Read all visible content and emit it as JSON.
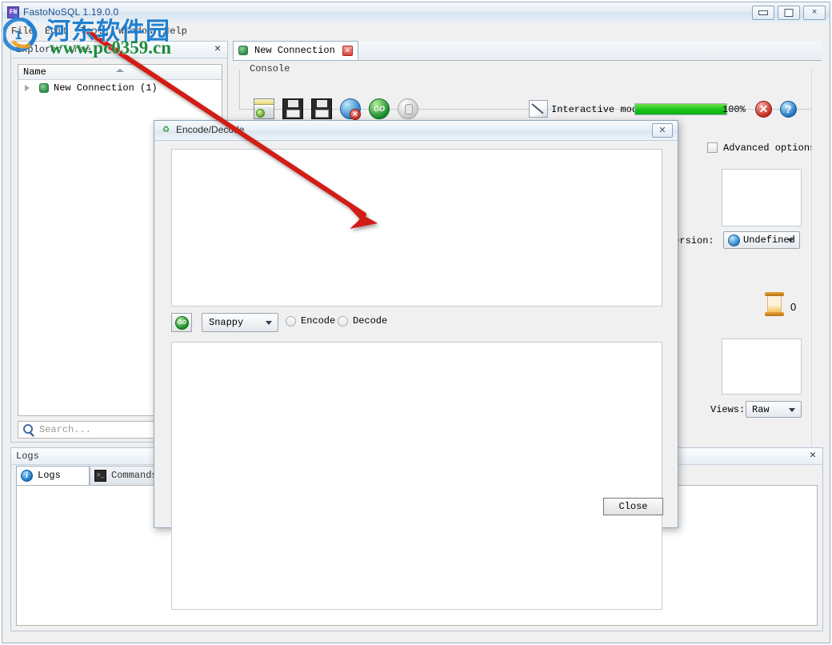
{
  "window": {
    "title": "FastoNoSQL 1.19.0.0",
    "icon": "app-icon",
    "icon_text": "FN",
    "controls": {
      "minimize": "–",
      "maximize": "□",
      "close": "✕"
    }
  },
  "menubar": {
    "items": [
      {
        "label": "File"
      },
      {
        "label": "Edit"
      },
      {
        "label": "Tools"
      },
      {
        "label": "Window"
      },
      {
        "label": "Help"
      }
    ]
  },
  "explorer": {
    "title": "Explorer tree",
    "close_label": "✕",
    "column_header": "Name",
    "nodes": [
      {
        "label": "New Connection (1)"
      }
    ],
    "search": {
      "placeholder": "Search...",
      "value": ""
    }
  },
  "logs_dock": {
    "title": "Logs",
    "close_label": "✕",
    "tabs": [
      {
        "label": "Logs",
        "icon": "info-icon",
        "icon_glyph": "i",
        "active": true
      },
      {
        "label": "Commands",
        "icon": "console-icon",
        "icon_glyph": ">_",
        "active": false
      }
    ]
  },
  "connection_tabs": [
    {
      "label": "New Connection",
      "close_label": "✕",
      "active": true
    }
  ],
  "console": {
    "group_label": "Console",
    "toolbar": [
      {
        "name": "new-window-icon",
        "tooltip": "New"
      },
      {
        "name": "save-icon",
        "tooltip": "Save"
      },
      {
        "name": "save-as-icon",
        "tooltip": "Save As"
      },
      {
        "name": "execute-stop-icon",
        "tooltip": "Execute / Stop"
      },
      {
        "name": "go-icon",
        "tooltip": "GO",
        "glyph": "GO"
      },
      {
        "name": "stop-hand-icon",
        "tooltip": "Stop"
      }
    ],
    "interactive_mode_label": "Interactive mode",
    "progress": {
      "percent_label": "100%",
      "value": 100
    },
    "error_icon_glyph": "✕",
    "help_icon_glyph": "?"
  },
  "right_panel": {
    "advanced_options_label": "Advanced options",
    "advanced_options_checked": false,
    "version_label": "version:",
    "version_value": "Undefined",
    "counter_value": "0",
    "views_label": "Views:",
    "views_value": "Raw"
  },
  "dialog": {
    "title": "Encode/Decode",
    "icon": "recycle-icon",
    "icon_glyph": "♻",
    "close_x_label": "✕",
    "input_text": "",
    "output_text": "",
    "go_button_glyph": "GO",
    "algorithm_value": "Snappy",
    "radios": [
      {
        "label": "Encode",
        "selected": false
      },
      {
        "label": "Decode",
        "selected": false
      }
    ],
    "close_button_label": "Close"
  },
  "watermark": {
    "chinese": "河东软件园",
    "url": "www.pc0359.cn"
  },
  "colors": {
    "accent_blue": "#1d4e8f",
    "progress_green": "#17c41a",
    "annotation_red": "#d21f14",
    "watermark_blue": "#1f7fd0",
    "watermark_green": "#1e8b3a"
  }
}
